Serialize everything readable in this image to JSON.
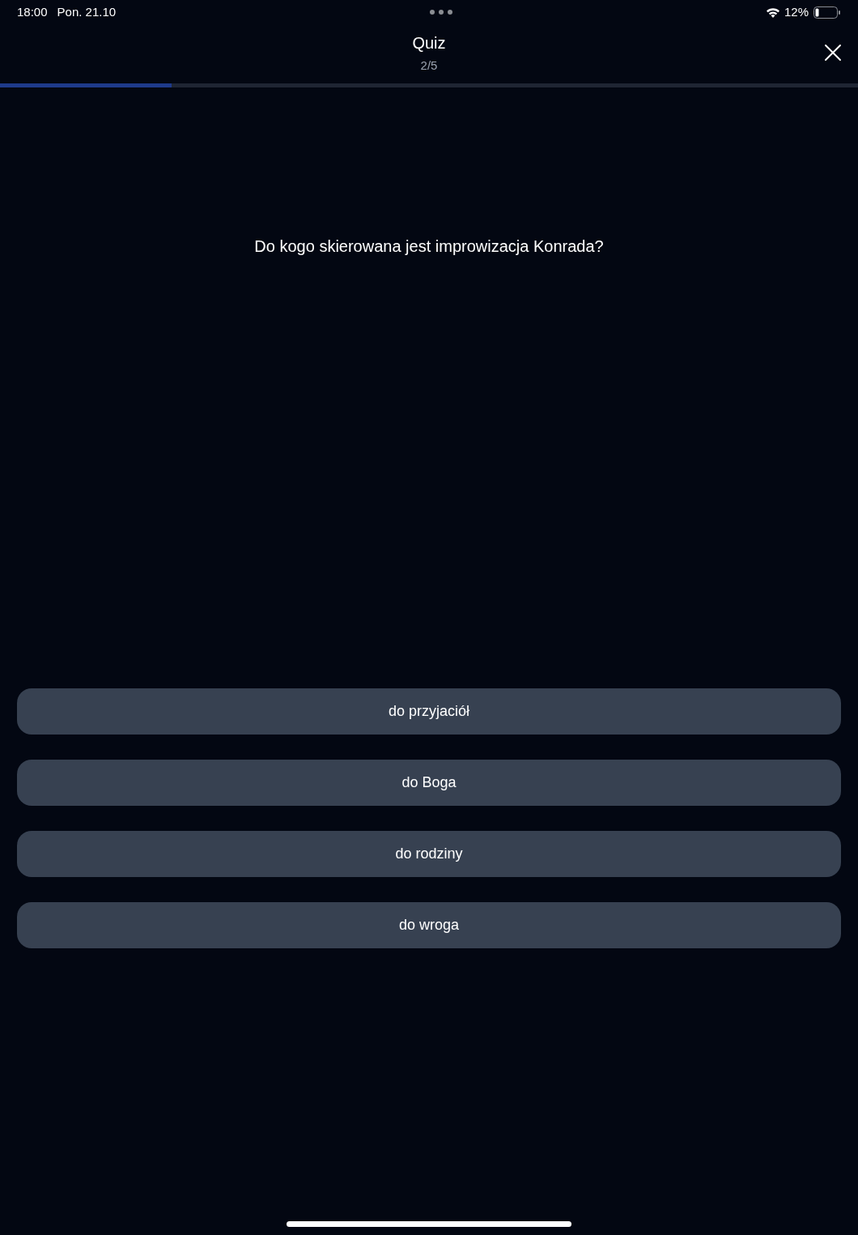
{
  "status_bar": {
    "time": "18:00",
    "date": "Pon. 21.10",
    "battery": "12%"
  },
  "header": {
    "title": "Quiz",
    "counter": "2/5"
  },
  "progress": {
    "level": 0.2
  },
  "question": "Do kogo skierowana jest improwizacja Konrada?",
  "answers": [
    {
      "label": "do przyjaciół",
      "selected": false
    },
    {
      "label": "do Boga",
      "selected": false
    },
    {
      "label": "do rodziny",
      "selected": false
    },
    {
      "label": "do wroga",
      "selected": false
    }
  ]
}
